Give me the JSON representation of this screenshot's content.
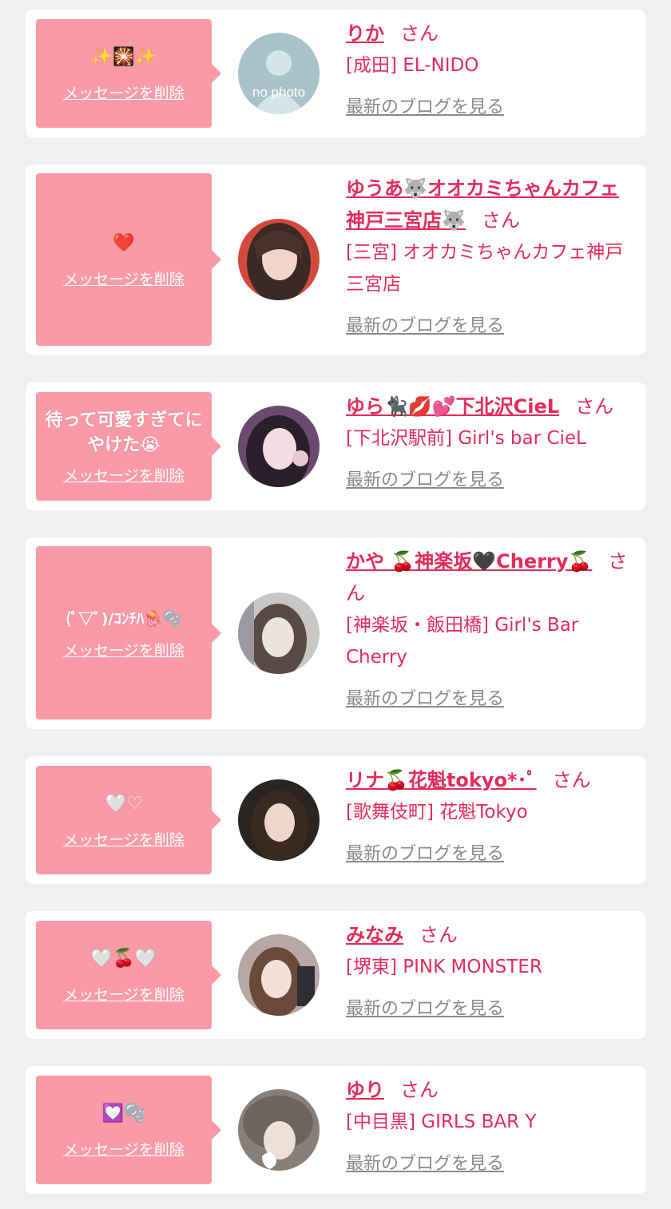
{
  "delete_label": "メッセージを削除",
  "honorific": "さん",
  "blog_label": "最新のブログを見る",
  "colors": {
    "accent": "#e52b5a",
    "bubble": "#fb9aa7",
    "background": "#f0f0f0"
  },
  "entries": [
    {
      "message": "✨🎇✨",
      "name": "りか",
      "shop": "[成田] EL-NIDO",
      "avatar_text": "no photo"
    },
    {
      "message": "❤️",
      "name": "ゆうあ🐺オオカミちゃんカフェ神戸三宮店🐺",
      "shop": "[三宮] オオカミちゃんカフェ神戸三宮店"
    },
    {
      "message": "待って可愛すぎてにやけた😭",
      "name": "ゆら🐈‍⬛💋💕下北沢CieL",
      "shop": "[下北沢駅前] Girl's bar CieL"
    },
    {
      "message": "(ﾟ▽ﾟ)/ｺﾝﾁﾊ🪼🫧",
      "name": "かや 🍒神楽坂🖤Cherry🍒",
      "shop": "[神楽坂・飯田橋] Girl's Bar Cherry"
    },
    {
      "message": "🤍♡",
      "name": "リナ🍒花魁tokyo*･ﾟ",
      "shop": "[歌舞伎町] 花魁Tokyo"
    },
    {
      "message": "🤍🍒🤍",
      "name": "みなみ",
      "shop": "[堺東] PINK MONSTER"
    },
    {
      "message": "💟🫧",
      "name": "ゆり",
      "shop": "[中目黒] GIRLS BAR Y"
    }
  ]
}
